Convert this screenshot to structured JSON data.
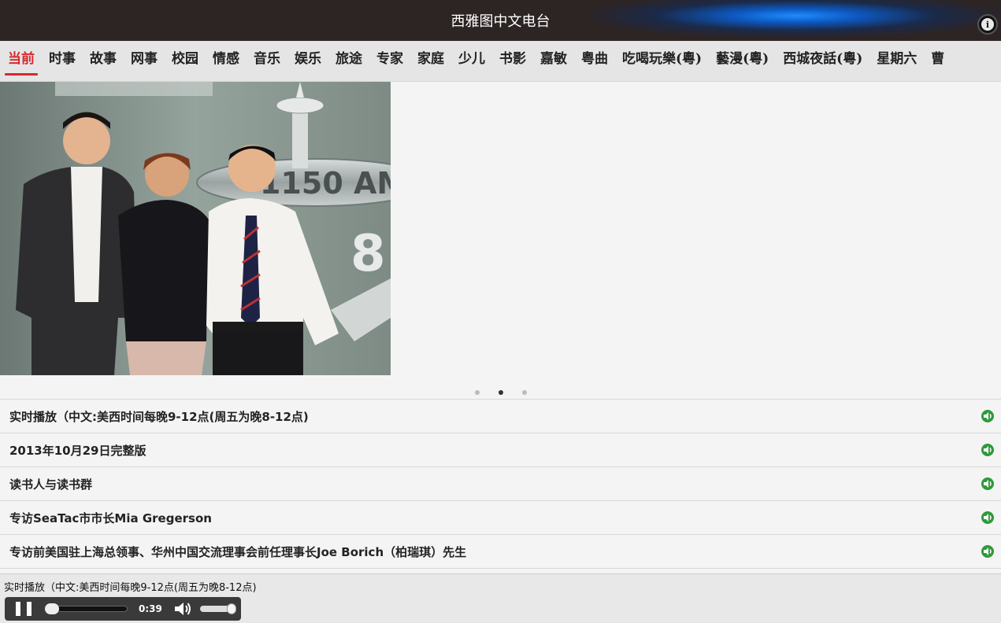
{
  "header": {
    "title": "西雅图中文电台",
    "info_icon": "info-icon"
  },
  "tabs": [
    {
      "label": "当前",
      "active": true
    },
    {
      "label": "时事"
    },
    {
      "label": "故事"
    },
    {
      "label": "网事"
    },
    {
      "label": "校园"
    },
    {
      "label": "情感"
    },
    {
      "label": "音乐"
    },
    {
      "label": "娱乐"
    },
    {
      "label": "旅途"
    },
    {
      "label": "专家"
    },
    {
      "label": "家庭"
    },
    {
      "label": "少儿"
    },
    {
      "label": "书影"
    },
    {
      "label": "嘉敏"
    },
    {
      "label": "粤曲"
    },
    {
      "label": "吃喝玩樂(粵)"
    },
    {
      "label": "藝漫(粵)"
    },
    {
      "label": "西城夜話(粵)"
    },
    {
      "label": "星期六"
    },
    {
      "label": "曹"
    }
  ],
  "photo": {
    "sign_text": "1150 AM",
    "sign_digit": "8"
  },
  "carousel": {
    "dots": 3,
    "active_index": 1
  },
  "episodes": [
    {
      "label": "实时播放（中文:美西时间每晚9-12点(周五为晚8-12点)"
    },
    {
      "label": "2013年10月29日完整版"
    },
    {
      "label": "读书人与读书群"
    },
    {
      "label": "专访SeaTac市市长Mia Gregerson"
    },
    {
      "label": "专访前美国驻上海总领事、华州中国交流理事会前任理事长Joe Borich（柏瑞琪）先生"
    }
  ],
  "player": {
    "now_playing": "实时播放（中文:美西时间每晚9-12点(周五为晚8-12点)",
    "time": "0:39",
    "progress": 0.02,
    "volume": 0.9
  },
  "colors": {
    "accent": "#d8282f",
    "speaker": "#2e9a3a",
    "header_bg": "#2d2424"
  }
}
